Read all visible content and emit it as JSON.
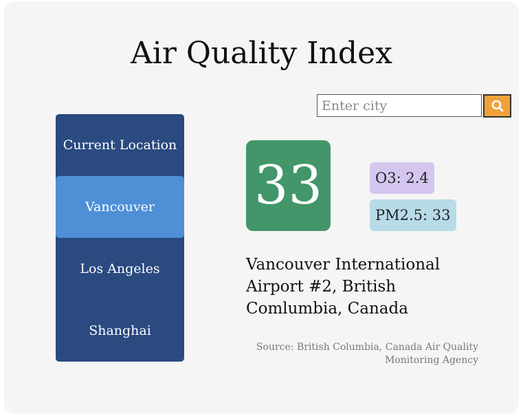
{
  "title": "Air Quality Index",
  "search": {
    "placeholder": "Enter city",
    "value": "",
    "button_icon": "search-icon",
    "button_color": "#f0a23a"
  },
  "sidebar": {
    "items": [
      {
        "label": "Current Location",
        "active": false
      },
      {
        "label": "Vancouver",
        "active": true
      },
      {
        "label": "Los Angeles",
        "active": false
      },
      {
        "label": "Shanghai",
        "active": false
      }
    ],
    "color": "#2a4a80",
    "active_color": "#4e8fd6"
  },
  "aqi": {
    "value": "33",
    "color": "#429669"
  },
  "pollutants": {
    "o3": {
      "label": "O3: 2.4",
      "color": "#d4c6ee"
    },
    "pm25": {
      "label": "PM2.5: 33",
      "color": "#b8dbe8"
    }
  },
  "station": {
    "name": "Vancouver International Airport #2, British Comlumbia, Canada"
  },
  "source": "Source: British Columbia, Canada Air Quality Monitoring Agency"
}
